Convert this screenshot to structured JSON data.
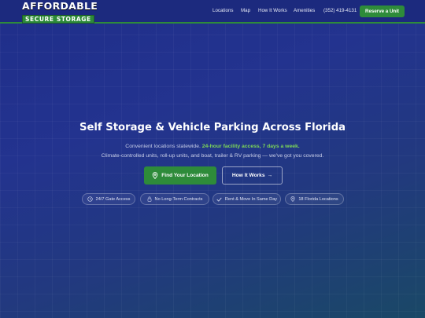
{
  "brand": {
    "line1": "AFFORDABLE",
    "line2": "SECURE STORAGE"
  },
  "nav": {
    "items": [
      "Locations",
      "Map",
      "How It Works",
      "Amenities"
    ],
    "phone": "(352) 419-4131",
    "cta": "Reserve a Unit"
  },
  "hero": {
    "title": "Self Storage & Vehicle Parking Across Florida",
    "line1_a": "Convenient locations statewide.",
    "line1_highlight": "24-hour facility access, 7 days a week.",
    "line2": "Climate-controlled units, roll-up units, and boat, trailer & RV parking — we've got you covered.",
    "primary_button": "Find Your Location",
    "secondary_button": "How It Works",
    "secondary_arrow": "→"
  },
  "features": [
    {
      "icon": "clock-icon",
      "label": "24/7 Gate Access"
    },
    {
      "icon": "lock-icon",
      "label": "No Long-Term Contracts"
    },
    {
      "icon": "check-icon",
      "label": "Rent & Move In Same Day"
    },
    {
      "icon": "pin-icon",
      "label": "18 Florida Locations"
    }
  ],
  "colors": {
    "brand_green": "#2e8b3a",
    "header_bg": "#1c2a7e",
    "highlight": "#7ed957"
  }
}
